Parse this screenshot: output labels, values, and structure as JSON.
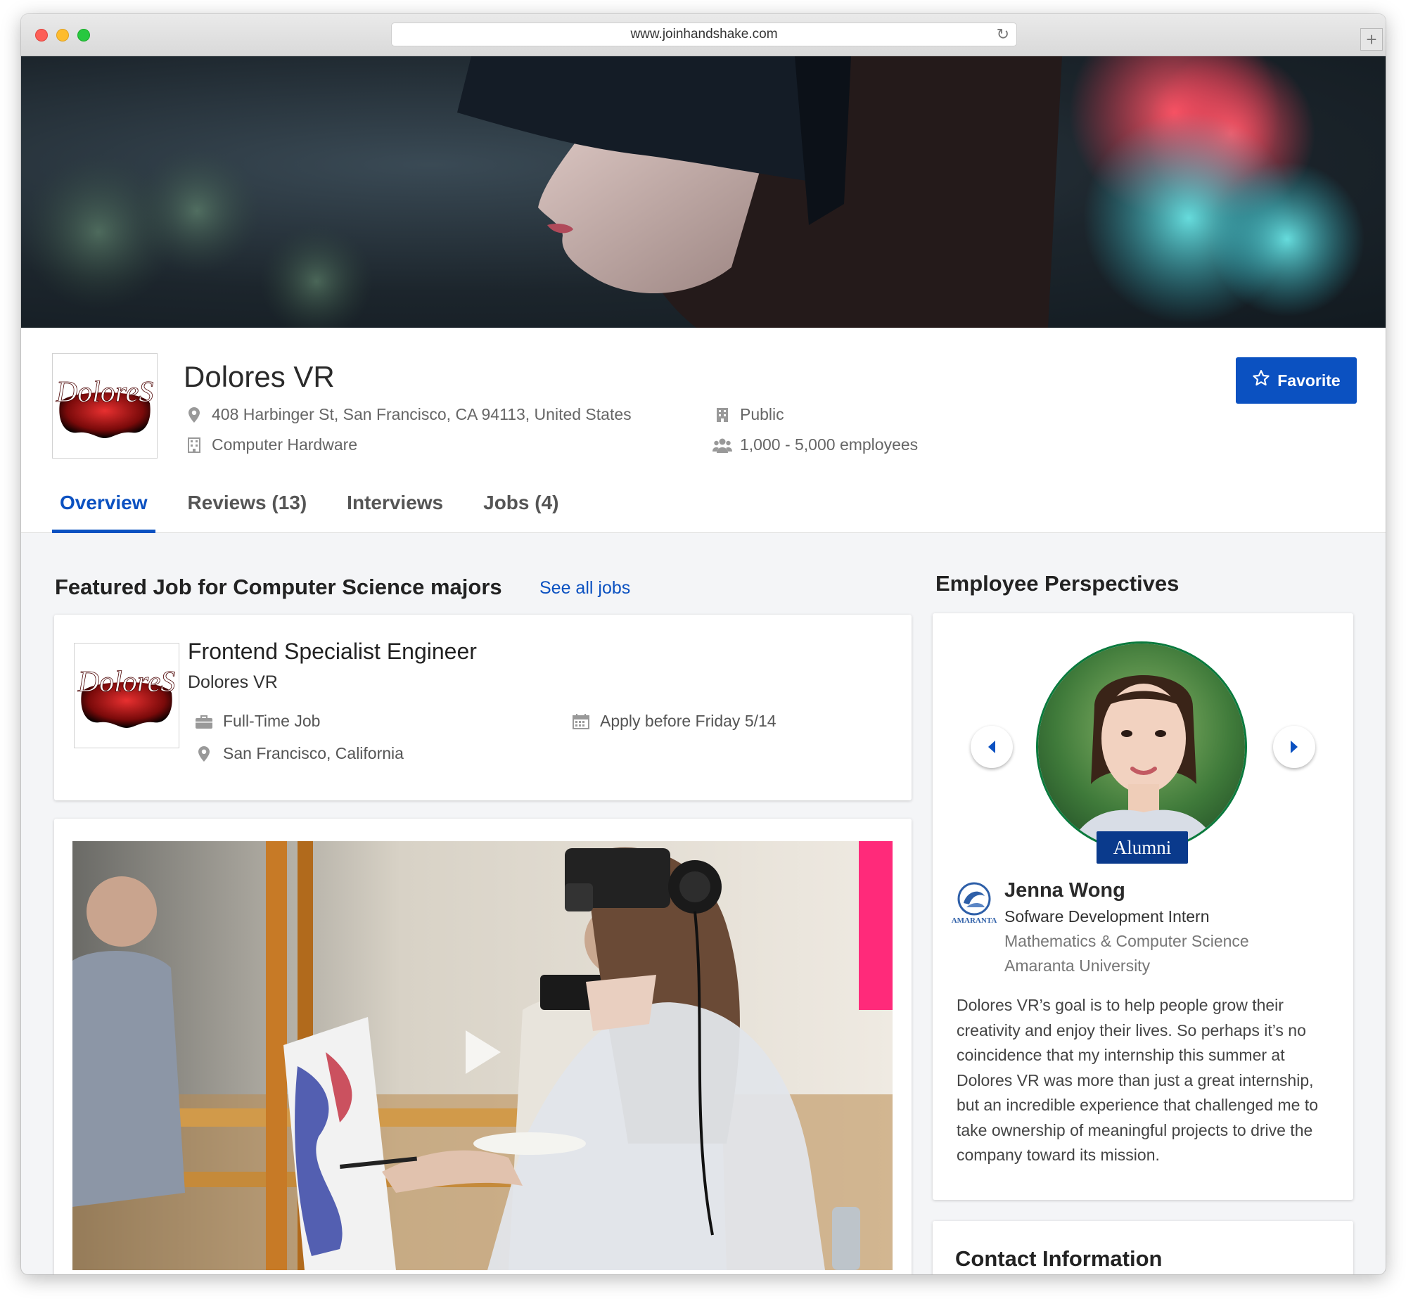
{
  "browser": {
    "url": "www.joinhandshake.com",
    "reload_icon": "reload-icon",
    "newtab_icon": "plus-icon"
  },
  "company": {
    "name": "Dolores VR",
    "logo_text": "DoloreS",
    "address": "408 Harbinger St, San Francisco, CA 94113, United States",
    "industry": "Computer Hardware",
    "ownership": "Public",
    "size": "1,000 - 5,000 employees",
    "favorite_label": "Favorite"
  },
  "tabs": [
    {
      "label": "Overview",
      "active": true
    },
    {
      "label": "Reviews (13)",
      "active": false
    },
    {
      "label": "Interviews",
      "active": false
    },
    {
      "label": "Jobs (4)",
      "active": false
    }
  ],
  "featured": {
    "heading": "Featured Job for Computer Science majors",
    "see_all": "See all jobs",
    "job": {
      "title": "Frontend Specialist Engineer",
      "company": "Dolores VR",
      "type": "Full-Time Job",
      "location": "San Francisco, California",
      "deadline": "Apply before Friday 5/14"
    }
  },
  "perspectives": {
    "heading": "Employee Perspectives",
    "badge": "Alumni",
    "name": "Jenna Wong",
    "role": "Sofware Development Intern",
    "major": "Mathematics & Computer Science",
    "school": "Amaranta University",
    "school_logo_text": "AMARANTA",
    "quote": "Dolores VR’s goal is to help people grow their creativity and enjoy their lives. So perhaps it’s no coincidence that my internship this summer at Dolores VR was more than just a great internship, but an incredible experience that challenged me to take ownership of meaningful projects to drive the company toward its mission."
  },
  "contact": {
    "heading": "Contact Information"
  },
  "colors": {
    "brand_blue": "#0b51c1",
    "badge_navy": "#0a3a8c",
    "page_bg": "#f4f5f7"
  }
}
